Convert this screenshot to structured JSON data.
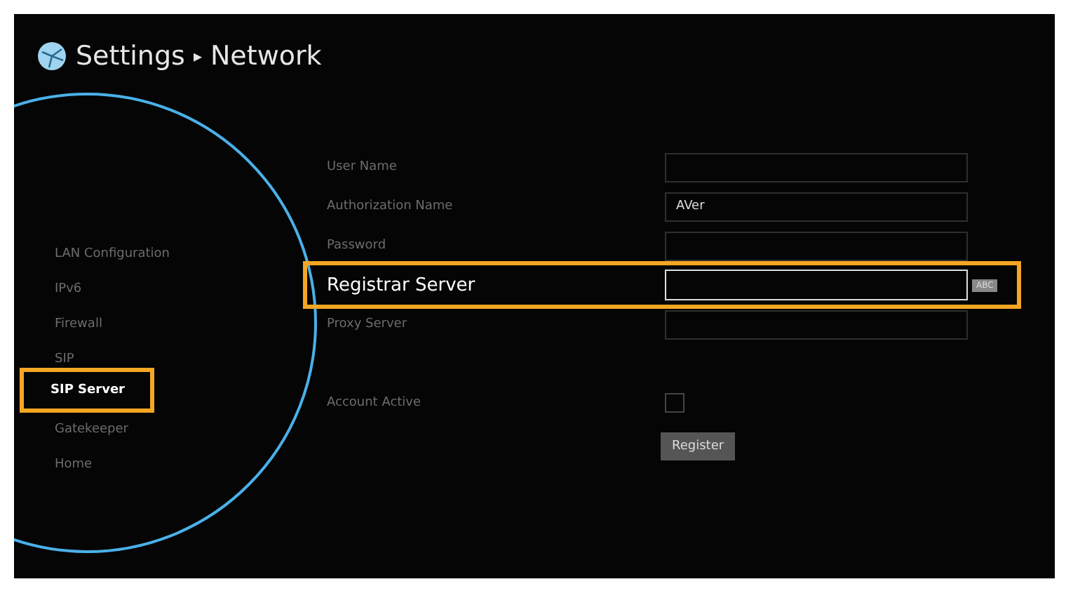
{
  "header": {
    "title": "Settings",
    "separator": "▸",
    "subtitle": "Network"
  },
  "sidebar": {
    "items": [
      {
        "label": "LAN Configuration",
        "selected": false
      },
      {
        "label": "IPv6",
        "selected": false
      },
      {
        "label": "Firewall",
        "selected": false
      },
      {
        "label": "SIP",
        "selected": false
      },
      {
        "label": "SIP Server",
        "selected": true
      },
      {
        "label": "Gatekeeper",
        "selected": false
      },
      {
        "label": "Home",
        "selected": false
      }
    ]
  },
  "form": {
    "fields": [
      {
        "kind": "text",
        "label": "User Name",
        "selected": false
      },
      {
        "kind": "text",
        "label": "Authorization Name",
        "value": "AVer",
        "selected": false
      },
      {
        "kind": "text",
        "label": "Password",
        "selected": false
      },
      {
        "kind": "text",
        "label": "Registrar Server",
        "selected": true,
        "input_mode": "ABC"
      },
      {
        "kind": "text",
        "label": "Proxy Server",
        "selected": false
      },
      {
        "kind": "checkbox",
        "label": "Account Active",
        "checked": false,
        "selected": false
      }
    ],
    "button": "Register"
  }
}
